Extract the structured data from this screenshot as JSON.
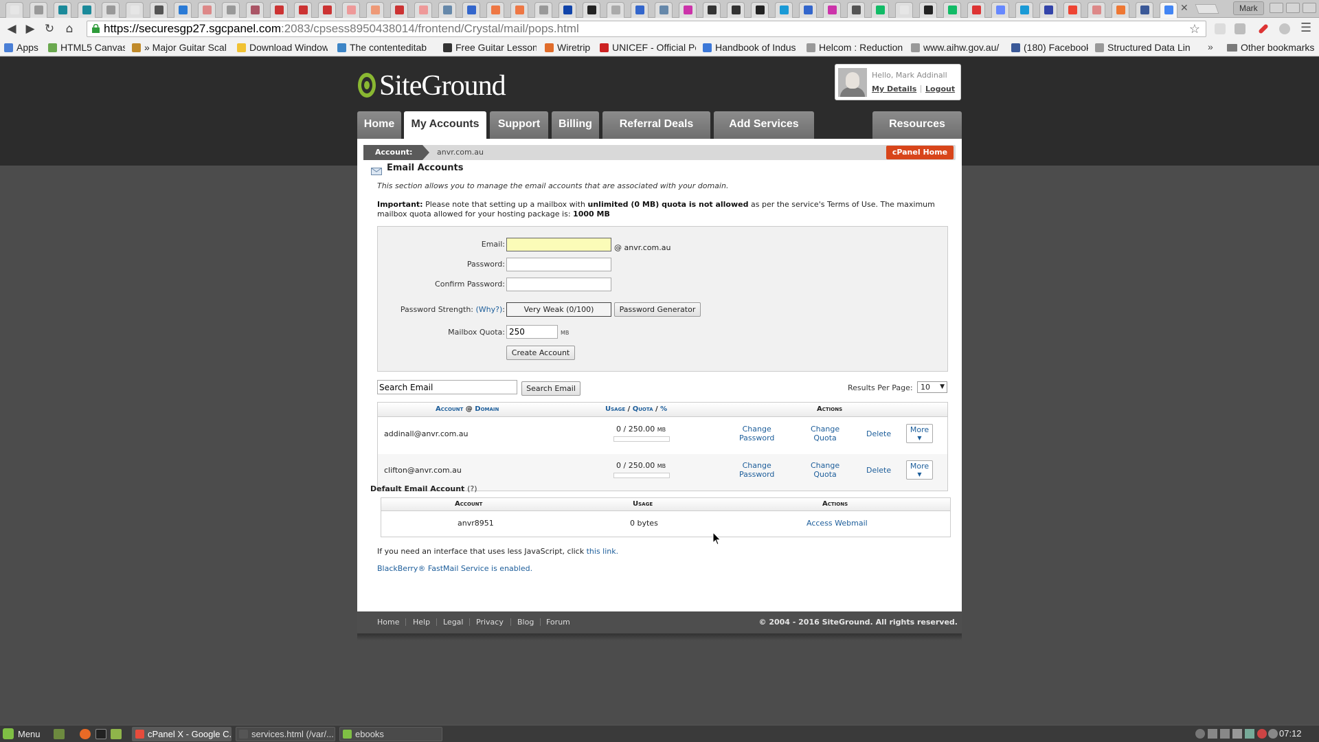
{
  "browser": {
    "url_host": "https://securesgp27.sgcpanel.com",
    "url_path": ":2083/cpsess8950438014/frontend/Crystal/mail/pops.html",
    "profile_name": "Mark",
    "bookmarks": [
      {
        "label": "Apps",
        "icon_color": "#4a7fd6"
      },
      {
        "label": "HTML5 Canvas",
        "icon_color": "#6aa84f"
      },
      {
        "label": "» Major Guitar Scal",
        "icon_color": "#c08a2a"
      },
      {
        "label": "Download Window",
        "icon_color": "#f1c232"
      },
      {
        "label": "The contenteditab",
        "icon_color": "#3d85c6"
      },
      {
        "label": "Free Guitar Lesson",
        "icon_color": "#333333"
      },
      {
        "label": "Wiretrip",
        "icon_color": "#e06c2a"
      },
      {
        "label": "UNICEF - Official Po",
        "icon_color": "#cc2222"
      },
      {
        "label": "Handbook of Indus",
        "icon_color": "#3c78d8"
      },
      {
        "label": "Helcom : Reduction",
        "icon_color": "#999999"
      },
      {
        "label": "www.aihw.gov.au/",
        "icon_color": "#999999"
      },
      {
        "label": "(180) Facebook",
        "icon_color": "#3b5998"
      },
      {
        "label": "Structured Data Lin",
        "icon_color": "#999999"
      }
    ],
    "other_bookmarks": "Other bookmarks",
    "tab_colors": [
      "#e6e6e6",
      "#999",
      "#1b8a9a",
      "#1b8a9a",
      "#999",
      "#e6e6e6",
      "#555",
      "#2b7bd6",
      "#d88",
      "#999",
      "#a56",
      "#c33",
      "#c33",
      "#c33",
      "#e99",
      "#e97",
      "#c33",
      "#e99",
      "#68a",
      "#36c",
      "#e74",
      "#e74",
      "#999",
      "#14a",
      "#222",
      "#aaa",
      "#36c",
      "#68a",
      "#c3a",
      "#333",
      "#333",
      "#222",
      "#1a9ad6",
      "#36c",
      "#c3a",
      "#555",
      "#1b6",
      "#e6e6e6",
      "#222",
      "#1b6",
      "#d33",
      "#68f",
      "#1a9ad6",
      "#34a",
      "#e43",
      "#d88",
      "#e73",
      "#3b5998",
      "#4285f4"
    ]
  },
  "header": {
    "logo_text": "SiteGround",
    "hello": "Hello, Mark Addinall",
    "my_details": "My Details",
    "logout": "Logout"
  },
  "nav": {
    "tabs": [
      {
        "label": "Home"
      },
      {
        "label": "My Accounts",
        "active": true
      },
      {
        "label": "Support"
      },
      {
        "label": "Billing"
      },
      {
        "label": "Referral Deals"
      },
      {
        "label": "Add Services"
      },
      {
        "label": "Resources"
      }
    ]
  },
  "account_bar": {
    "label": "Account:",
    "domain": "anvr.com.au",
    "cpanel_home": "cPanel Home"
  },
  "section": {
    "title": "Email Accounts",
    "description": "This section allows you to manage the email accounts that are associated with your domain.",
    "important_label": "Important:",
    "important_text_1": "Please note that setting up a mailbox with",
    "important_bold": "unlimited (0 MB) quota is not allowed",
    "important_text_2": "as per the service's Terms of Use. The maximum mailbox quota allowed for your hosting package is:",
    "important_max": "1000 MB"
  },
  "form": {
    "email_label": "Email:",
    "email_value": "",
    "email_suffix": "@ anvr.com.au",
    "password_label": "Password:",
    "confirm_label": "Confirm Password:",
    "strength_label": "Password Strength:",
    "why_link": "(Why?)",
    "strength_colon": ":",
    "strength_value": "Very Weak (0/100)",
    "generator_button": "Password Generator",
    "quota_label": "Mailbox Quota:",
    "quota_value": "250",
    "quota_unit": "MB",
    "create_button": "Create Account"
  },
  "search": {
    "input_value": "Search Email",
    "button": "Search Email",
    "results_label": "Results Per Page:",
    "results_value": "10"
  },
  "accounts_table": {
    "col_account": "Account",
    "col_at": "@",
    "col_domain": "Domain",
    "col_usage": "Usage",
    "col_slash": "/",
    "col_quota": "Quota",
    "col_slash2": "/",
    "col_percent": "%",
    "col_actions": "Actions",
    "rows": [
      {
        "email": "addinall@anvr.com.au",
        "usage": "0 / 250.00",
        "unit": "MB",
        "usage_fraction": 0,
        "change_password_1": "Change",
        "change_password_2": "Password",
        "change_quota_1": "Change",
        "change_quota_2": "Quota",
        "delete": "Delete",
        "more": "More"
      },
      {
        "email": "clifton@anvr.com.au",
        "usage": "0 / 250.00",
        "unit": "MB",
        "usage_fraction": 0,
        "change_password_1": "Change",
        "change_password_2": "Password",
        "change_quota_1": "Change",
        "change_quota_2": "Quota",
        "delete": "Delete",
        "more": "More"
      }
    ]
  },
  "default_account": {
    "heading": "Default Email Account",
    "help": "(?)",
    "col_account": "Account",
    "col_usage": "Usage",
    "col_actions": "Actions",
    "account": "anvr8951",
    "usage": "0 bytes",
    "action": "Access Webmail"
  },
  "notes": {
    "less_js_text": "If you need an interface that uses less JavaScript, click",
    "less_js_link": "this link.",
    "blackberry": "BlackBerry® FastMail Service is enabled."
  },
  "footer": {
    "links": [
      "Home",
      "Help",
      "Legal",
      "Privacy",
      "Blog",
      "Forum"
    ],
    "copyright": "© 2004 - 2016 SiteGround. All rights reserved."
  },
  "taskbar": {
    "menu": "Menu",
    "windows": [
      {
        "label": "cPanel X - Google C...",
        "icon_color": "#e74c3c",
        "active": true
      },
      {
        "label": "services.html (/var/...",
        "icon_color": "#555555"
      },
      {
        "label": "ebooks",
        "icon_color": "#7fbf44"
      }
    ],
    "clock": "07:12"
  },
  "colors": {
    "accent_orange": "#d8451a",
    "link_blue": "#1c5d9a",
    "dark_band": "#2c2c2c"
  }
}
